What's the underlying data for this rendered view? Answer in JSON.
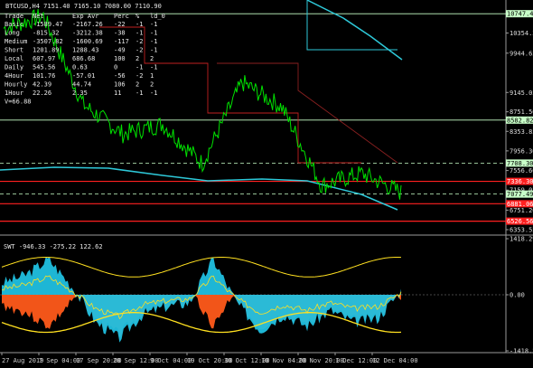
{
  "header": {
    "symbol_line": "BTCUSD,H4  7151.40 7165.10 7080.00 7110.90"
  },
  "stats_table": {
    "headers": [
      "Trade",
      "Net",
      "Exp Avr",
      "Perc",
      "%",
      "ld_0"
    ],
    "rows": [
      [
        "Basic",
        "-1589.47",
        "-2167.26",
        "-22",
        "-1",
        "-1"
      ],
      [
        "Long",
        "-815.32",
        "-3212.38",
        "-38",
        "-1",
        "-1"
      ],
      [
        "Medium",
        "-3507.82",
        "-1600.69",
        "-117",
        "-2",
        "-1"
      ],
      [
        "Short",
        "1201.89",
        "1288.43",
        "-49",
        "-2",
        "-1"
      ],
      [
        "Local",
        "607.97",
        "686.68",
        "100",
        "2",
        "2"
      ],
      [
        "Daily",
        "545.56",
        "0.63",
        "0",
        "-1",
        "-1"
      ],
      [
        "4Hour",
        "101.76",
        "-57.01",
        "-56",
        "-2",
        "1"
      ],
      [
        "Hourly",
        "42.39",
        "44.74",
        "106",
        "2",
        "2"
      ],
      [
        "1Hour",
        "22.26",
        "2.35",
        "11",
        "-1",
        "-1"
      ]
    ],
    "extra": "V=66.88"
  },
  "price_axis": {
    "ticks": [
      "10747.45",
      "10354.35",
      "9944.65",
      "9145.05",
      "8751.50",
      "8353.85",
      "7956.30",
      "7556.60",
      "7159.05",
      "6751.20",
      "6353.55"
    ],
    "markers": [
      {
        "label": "10747.45",
        "bg": "#c8ffc8",
        "fg": "#000000"
      },
      {
        "label": "8582.82",
        "bg": "#c8ffc8",
        "fg": "#000000"
      },
      {
        "label": "7708.30",
        "bg": "#c8ffc8",
        "fg": "#000000"
      },
      {
        "label": "7336.30",
        "bg": "#ff2020",
        "fg": "#ffffff"
      },
      {
        "label": "7077.49",
        "bg": "#c8ffc8",
        "fg": "#000000"
      },
      {
        "label": "6881.06",
        "bg": "#ff2020",
        "fg": "#ffffff"
      },
      {
        "label": "6526.56",
        "bg": "#ff2020",
        "fg": "#ffffff"
      }
    ]
  },
  "indicator": {
    "label": "SWT -946.33 -275.22 122.62",
    "ticks": [
      "1418.29",
      "0.00",
      "-1418.29"
    ]
  },
  "time_axis": {
    "ticks": [
      "27 Aug 2019",
      "7 Sep 04:00",
      "17 Sep 20:00",
      "28 Sep 12:00",
      "9 Oct 04:00",
      "19 Oct 20:00",
      "30 Oct 12:00",
      "10 Nov 04:00",
      "20 Nov 20:00",
      "1 Dec 12:00",
      "12 Dec 04:00"
    ]
  },
  "colors": {
    "price_line": "#00e000",
    "channel": "#2ec8d8",
    "levels": "#c02020",
    "dashed_level": "#c8ffc8",
    "osc_orange": "#ff5a1a",
    "osc_cyan": "#20c0e0",
    "osc_yellow": "#ffe020"
  },
  "chart_data": [
    {
      "type": "line",
      "title": "BTCUSD,H4  7151.40 7165.10 7080.00 7110.90",
      "x": [
        "27 Aug 2019",
        "7 Sep 04:00",
        "17 Sep 20:00",
        "28 Sep 12:00",
        "9 Oct 04:00",
        "19 Oct 20:00",
        "30 Oct 12:00",
        "10 Nov 04:00",
        "20 Nov 20:00",
        "1 Dec 12:00",
        "12 Dec 04:00"
      ],
      "series": [
        {
          "values": [
            10450,
            10700,
            8900,
            8300,
            8500,
            7700,
            9350,
            8850,
            7250,
            7500,
            7110
          ]
        }
      ],
      "ylim": [
        6353.55,
        11100
      ],
      "grid": false
    },
    {
      "type": "area",
      "title": "SWT -946.33 -275.22 122.62",
      "ylim": [
        -1418.29,
        1418.29
      ],
      "series": [
        {
          "values": [
            300,
            500,
            900,
            200,
            -700,
            -1100,
            -500,
            -300,
            -200,
            900,
            -200,
            -900,
            -500,
            -800,
            -400,
            -700,
            -600,
            100
          ]
        }
      ]
    }
  ]
}
